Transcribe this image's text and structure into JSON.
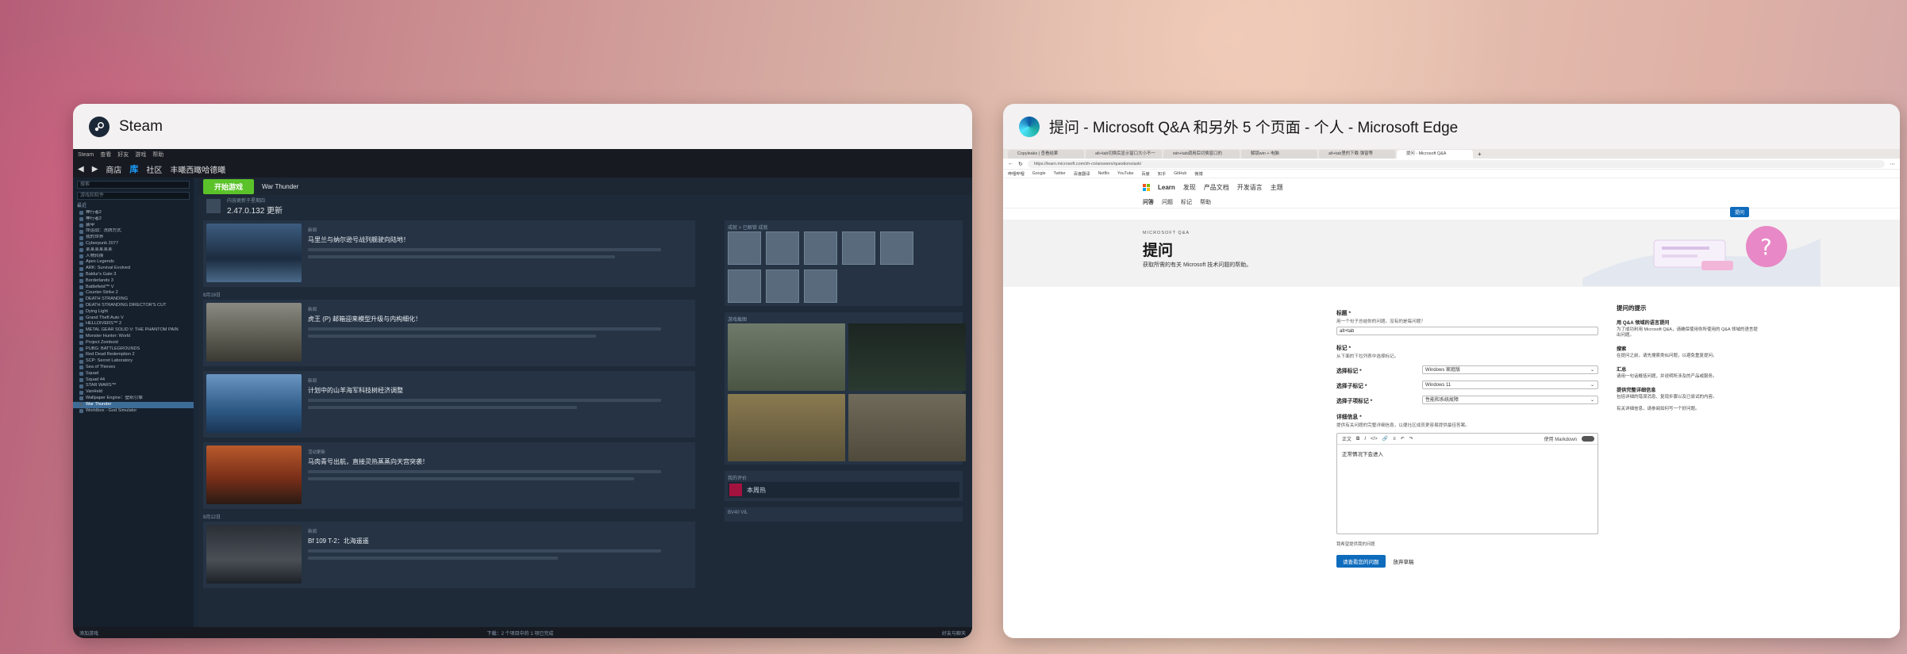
{
  "steam_window": {
    "title": "Steam",
    "top_menu": [
      "Steam",
      "查看",
      "好友",
      "游戏",
      "帮助"
    ],
    "nav": [
      "商店",
      "库",
      "社区",
      "丰曦西瞰哈德曦"
    ],
    "search_placeholder": "搜索",
    "sidebar_filter": "游戏和软件",
    "sidebar_header": "最近",
    "sidebar_games": [
      "神行者2",
      "神行者2",
      "装甲",
      "命运战：洗牌方式",
      "我的世界",
      "Cyberpunk 2077",
      "某某某某某某",
      "人物转换",
      "Apex Legends",
      "ARK: Survival Evolved",
      "Baldur's Gate 3",
      "Borderlands 3",
      "Battlefield™ V",
      "Counter-Strike 2",
      "DEATH STRANDING",
      "DEATH STRANDING DIRECTOR'S CUT",
      "Dying Light",
      "Grand Theft Auto V",
      "HELLDIVERS™ 2",
      "METAL GEAR SOLID V: THE PHANTOM PAIN",
      "Monster Hunter: World",
      "Project Zomboid",
      "PUBG: BATTLEGROUNDS",
      "Red Dead Redemption 2",
      "SCP: Secret Laboratory",
      "Sea of Thieves",
      "Squad",
      "Squad 44",
      "STAR WARS™",
      "VanHeld",
      "Wallpaper Engine：壁纸引擎",
      "War Thunder",
      "Worldbox - God Simulator"
    ],
    "sidebar_selected": "War Thunder",
    "play_button": "开始游戏",
    "game_name": "War Thunder",
    "update_version": "2.47.0.132 更新",
    "update_label": "内容更新于星期四",
    "news": [
      {
        "tag": "新闻",
        "title": "马里兰与纳尔逊号战列舰驶向陆地！"
      },
      {
        "tag": "新闻",
        "title": "虎王 (P) 邮箱迎来模型升级与内构细化！"
      },
      {
        "tag": "新闻",
        "title": "计划中的山羊海军科技树经济调整"
      },
      {
        "tag": "活动更新",
        "title": "马肉青号出航，直接灵热蒸蒸向天宫突袭！"
      },
      {
        "tag": "新闻",
        "title": "Bf 109 T-2：北海遥遥"
      }
    ],
    "news_dates": [
      "8月19日",
      "8月12日"
    ],
    "panels": {
      "achievements": "成就 > 已解锁 成就",
      "screenshots": "游戏截图",
      "activity": "我的评价",
      "friends": "BV40 VIL"
    },
    "friend_name": "本周热",
    "bottom_left": "添加游戏",
    "bottom_center": "下载：2 个项目中的 1 项已完成",
    "bottom_right": "好友与聊天"
  },
  "edge_window": {
    "title": "提问 - Microsoft Q&A 和另外 5 个页面 - 个人 - Microsoft Edge",
    "tabs": [
      "Copyleaks | 查看结果",
      "alt+tab切换后显示窗口大小不一",
      "win+tab调用后切换窗口的",
      "解锁win + 电脑",
      "alt+tab里的下载·弹窗等",
      "提问 - Microsoft Q&A"
    ],
    "url": "https://learn.microsoft.com/zh-cn/answers/questions/ask/",
    "favorites": [
      "哔哩哔哩",
      "Google",
      "Twitter",
      "百度翻译",
      "Netflix",
      "YouTube",
      "百度",
      "知乎",
      "GitHub",
      "微博"
    ],
    "learn_brand": "Learn",
    "learn_menu": [
      "发现",
      "产品文档",
      "开发语言",
      "主题"
    ],
    "subnav": [
      "问答",
      "问题",
      "标记",
      "帮助"
    ],
    "ask_button": "提问",
    "hero_kicker": "MICROSOFT Q&A",
    "hero_title": "提问",
    "hero_subtitle": "获取所需的有关 Microsoft 技术问题的帮助。",
    "form": {
      "title_label": "标题 *",
      "title_help": "用一个句子总结你的问题。没有的是每问题？",
      "title_value": "alt+tab",
      "tags_label": "标记 *",
      "tags_help": "从下面的下拉列表中选择标记。",
      "select1_label": "选择标记 *",
      "select1_value": "Windows 家庭版",
      "select2_label": "选择子标记 *",
      "select2_value": "Windows 11",
      "select3_label": "选择子项标记 *",
      "select3_value": "性能和系统故障",
      "detail_label": "详细信息 *",
      "detail_help": "提供有关问题的完整详细信息，以便社区成员更容易提供最佳答案。",
      "toolbar_text": "正文",
      "markdown_toggle": "使用 Markdown",
      "editor_text": "正常情况下会进入",
      "checkbox_text": "我希望提供我的问题",
      "submit": "请查看您的问题",
      "discard": "放弃草稿"
    },
    "tips": {
      "heading": "提问的提示",
      "sections": [
        {
          "h": "用 Q&A 领域的语言提问",
          "p": "为了成功利用 Microsoft Q&A，请确保使用你所使用的 Q&A 领域的语言提出问题。"
        },
        {
          "h": "搜索",
          "p": "在提问之前，请先搜索类似问题，以避免重复提问。"
        },
        {
          "h": "汇总",
          "p": "请用一句话概括问题，并说明所涉及的产品或服务。"
        },
        {
          "h": "提供完整详细信息",
          "p": "包括详细的错误消息、复现步骤以及已尝试的内容。"
        }
      ],
      "footer": "有关详细信息，请参阅如何写一个好问题。"
    }
  }
}
